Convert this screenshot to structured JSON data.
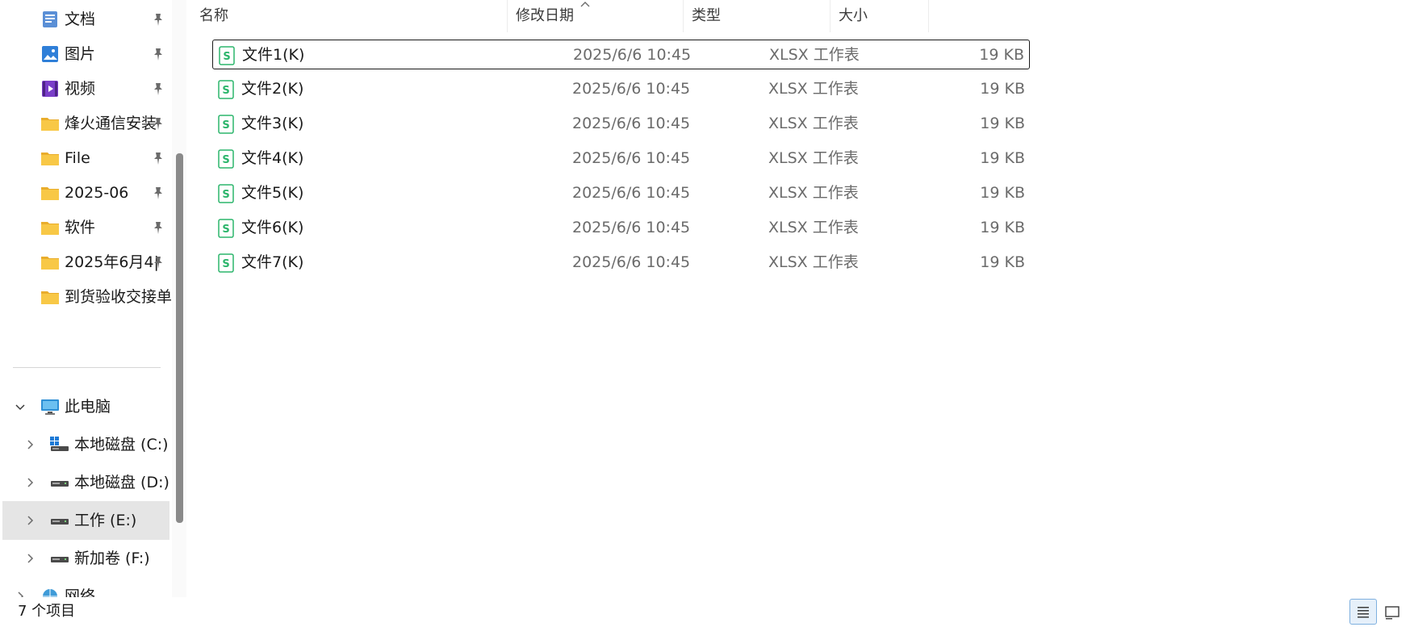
{
  "nav": {
    "quick_access": [
      {
        "label": "文档",
        "icon": "documents-icon",
        "pinned": true
      },
      {
        "label": "图片",
        "icon": "pictures-icon",
        "pinned": true
      },
      {
        "label": "视频",
        "icon": "videos-icon",
        "pinned": true
      },
      {
        "label": "烽火通信安装",
        "icon": "folder-icon",
        "pinned": true
      },
      {
        "label": "File",
        "icon": "folder-icon",
        "pinned": true
      },
      {
        "label": "2025-06",
        "icon": "folder-icon",
        "pinned": true
      },
      {
        "label": "软件",
        "icon": "folder-icon",
        "pinned": true
      },
      {
        "label": "2025年6月4|",
        "icon": "folder-icon",
        "pinned": true
      },
      {
        "label": "到货验收交接单",
        "icon": "folder-icon",
        "pinned": false
      }
    ],
    "this_pc": {
      "label": "此电脑",
      "icon": "computer-icon",
      "expanded": true
    },
    "drives": [
      {
        "label": "本地磁盘 (C:)",
        "icon": "windows-drive-icon",
        "selected": false
      },
      {
        "label": "本地磁盘 (D:)",
        "icon": "drive-icon",
        "selected": false
      },
      {
        "label": "工作 (E:)",
        "icon": "drive-icon",
        "selected": true
      },
      {
        "label": "新加卷 (F:)",
        "icon": "drive-icon",
        "selected": false
      }
    ],
    "network": {
      "label": "网络",
      "icon": "network-icon"
    }
  },
  "columns": {
    "name": "名称",
    "modified": "修改日期",
    "type": "类型",
    "size": "大小",
    "sorted_by": "name"
  },
  "files": [
    {
      "name": "文件1(K)",
      "modified": "2025/6/6 10:45",
      "type": "XLSX 工作表",
      "size": "19 KB"
    },
    {
      "name": "文件2(K)",
      "modified": "2025/6/6 10:45",
      "type": "XLSX 工作表",
      "size": "19 KB"
    },
    {
      "name": "文件3(K)",
      "modified": "2025/6/6 10:45",
      "type": "XLSX 工作表",
      "size": "19 KB"
    },
    {
      "name": "文件4(K)",
      "modified": "2025/6/6 10:45",
      "type": "XLSX 工作表",
      "size": "19 KB"
    },
    {
      "name": "文件5(K)",
      "modified": "2025/6/6 10:45",
      "type": "XLSX 工作表",
      "size": "19 KB"
    },
    {
      "name": "文件6(K)",
      "modified": "2025/6/6 10:45",
      "type": "XLSX 工作表",
      "size": "19 KB"
    },
    {
      "name": "文件7(K)",
      "modified": "2025/6/6 10:45",
      "type": "XLSX 工作表",
      "size": "19 KB"
    }
  ],
  "status": {
    "item_count": "7 个项目"
  },
  "colors": {
    "selected_bg": "#e5e5e5",
    "folder_yellow": "#f8c846",
    "sheet_green": "#2bb56b",
    "view_active_border": "#7fb0df"
  }
}
